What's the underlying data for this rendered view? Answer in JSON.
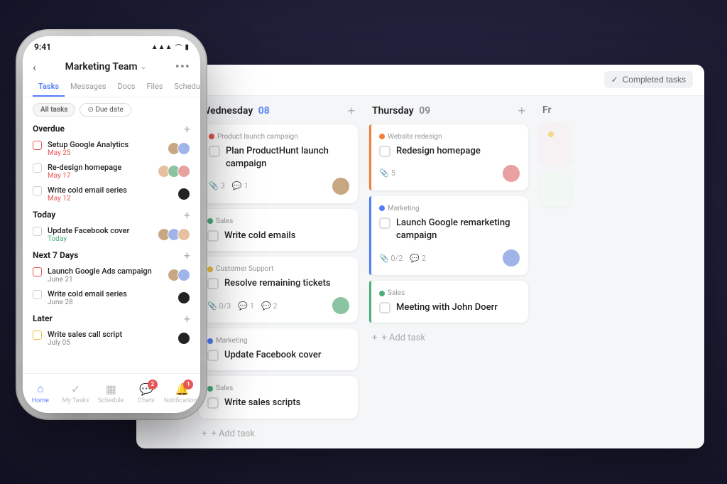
{
  "app": {
    "background": "#1a1a2e"
  },
  "desktop": {
    "header": {
      "day_tab": "...day",
      "completed_tasks_label": "Completed tasks"
    },
    "columns": [
      {
        "day": "Wednesday",
        "num": "08",
        "num_color": "blue",
        "cards": [
          {
            "tag": "Product launch campaign",
            "tag_color": "#e85555",
            "title": "Plan ProductHunt launch campaign",
            "border": "red",
            "meta_attach": "3",
            "meta_comment": "1",
            "has_avatar": true
          },
          {
            "tag": "Sales",
            "tag_color": "#4caf7d",
            "title": "Write cold emails",
            "border": "none",
            "has_avatar": false
          },
          {
            "tag": "Customer Support",
            "tag_color": "#f0c040",
            "title": "Resolve remaining tickets",
            "border": "none",
            "meta_attach": "0/3",
            "meta_comment1": "1",
            "meta_comment2": "2",
            "has_avatar": true
          },
          {
            "tag": "Marketing",
            "tag_color": "#4f7ef8",
            "title": "Update Facebook cover",
            "border": "none",
            "has_avatar": false
          },
          {
            "tag": "Sales",
            "tag_color": "#4caf7d",
            "title": "Write sales scripts",
            "border": "none",
            "has_avatar": false
          }
        ],
        "add_task": "+ Add task"
      },
      {
        "day": "Thursday",
        "num": "09",
        "num_color": "gray",
        "cards": [
          {
            "tag": "Website redesign",
            "tag_color": "#f0803a",
            "title": "Redesign homepage",
            "border": "orange",
            "meta_attach": "5",
            "has_avatar": true
          },
          {
            "tag": "Marketing",
            "tag_color": "#4f7ef8",
            "title": "Launch Google remarketing campaign",
            "border": "blue",
            "meta_attach": "0/2",
            "meta_comment": "2",
            "has_avatar": true
          },
          {
            "tag": "Sales",
            "tag_color": "#4caf7d",
            "title": "Meeting with John Doerr",
            "border": "green",
            "has_avatar": false
          }
        ],
        "add_task": "+ Add task"
      }
    ]
  },
  "mobile": {
    "status_bar": {
      "time": "9:41",
      "signal": "▲▲▲",
      "wifi": "wifi",
      "battery": "🔋"
    },
    "header": {
      "back_label": "‹",
      "title": "Marketing Team",
      "chevron": "⌄",
      "more": "•••"
    },
    "tabs": [
      {
        "label": "Tasks",
        "active": true
      },
      {
        "label": "Messages",
        "active": false
      },
      {
        "label": "Docs",
        "active": false
      },
      {
        "label": "Files",
        "active": false
      },
      {
        "label": "Schedule",
        "active": false
      }
    ],
    "filters": [
      {
        "label": "All tasks",
        "active": true
      },
      {
        "label": "⊙ Due date",
        "active": false
      }
    ],
    "sections": [
      {
        "title": "Overdue",
        "add_btn": "+",
        "tasks": [
          {
            "name": "Setup Google Analytics",
            "date": "May 25",
            "date_color": "red",
            "check_color": "red",
            "avatars": [
              "ta-1",
              "ta-2"
            ]
          },
          {
            "name": "Re-design homepage",
            "date": "May 17",
            "date_color": "red",
            "check_color": "normal",
            "avatars": [
              "ta-3",
              "ta-4",
              "ta-5"
            ]
          },
          {
            "name": "Write cold email series",
            "date": "May 12",
            "date_color": "red",
            "check_color": "normal",
            "avatars": [
              "ta-6"
            ]
          }
        ]
      },
      {
        "title": "Today",
        "add_btn": "+",
        "tasks": [
          {
            "name": "Update Facebook cover",
            "date": "Today",
            "date_color": "green",
            "check_color": "normal",
            "avatars": [
              "ta-1",
              "ta-2",
              "ta-3"
            ]
          }
        ]
      },
      {
        "title": "Next 7 Days",
        "add_btn": "+",
        "tasks": [
          {
            "name": "Launch Google Ads campaign",
            "date": "June 21",
            "date_color": "gray",
            "check_color": "red",
            "avatars": [
              "ta-1",
              "ta-2"
            ]
          },
          {
            "name": "Write cold email series",
            "date": "June 28",
            "date_color": "gray",
            "check_color": "normal",
            "avatars": [
              "ta-6"
            ]
          }
        ]
      },
      {
        "title": "Later",
        "add_btn": "+",
        "tasks": [
          {
            "name": "Write sales call script",
            "date": "July 05",
            "date_color": "gray",
            "check_color": "yellow",
            "avatars": [
              "ta-6"
            ]
          }
        ]
      }
    ],
    "bottom_nav": [
      {
        "icon": "⌂",
        "label": "Home",
        "active": true,
        "badge": null
      },
      {
        "icon": "✓",
        "label": "My Tasks",
        "active": false,
        "badge": null
      },
      {
        "icon": "▦",
        "label": "Schedule",
        "active": false,
        "badge": null
      },
      {
        "icon": "💬",
        "label": "Chats",
        "active": false,
        "badge": "2"
      },
      {
        "icon": "🔔",
        "label": "Notifications",
        "active": false,
        "badge": "1"
      }
    ]
  }
}
